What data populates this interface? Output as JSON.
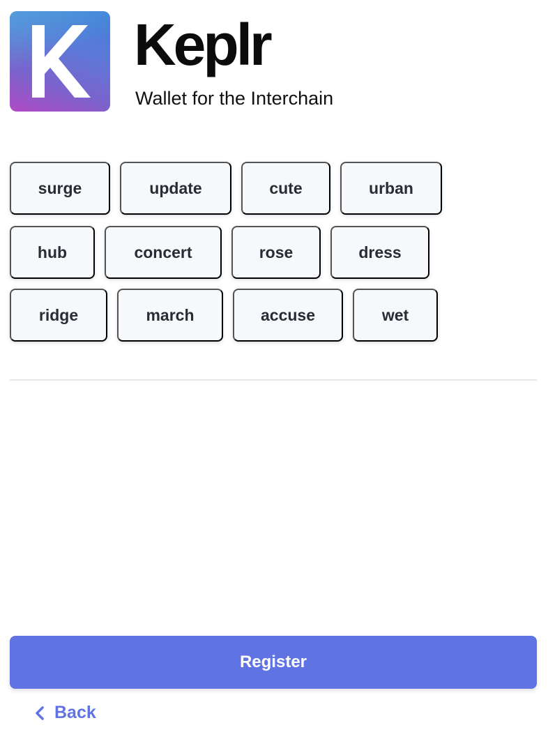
{
  "brand": {
    "logo_letter": "K",
    "name": "Keplr",
    "tagline": "Wallet for the Interchain"
  },
  "words": [
    [
      "surge",
      "update",
      "cute",
      "urban"
    ],
    [
      "hub",
      "concert",
      "rose",
      "dress"
    ],
    [
      "ridge",
      "march",
      "accuse",
      "wet"
    ]
  ],
  "actions": {
    "register_label": "Register",
    "back_label": "Back"
  },
  "colors": {
    "accent": "#5f73e3",
    "chip_background": "#f6f9fc",
    "text": "#2a2b33"
  },
  "icons": {
    "logo": "keplr-logo-icon",
    "back": "chevron-left-icon"
  }
}
